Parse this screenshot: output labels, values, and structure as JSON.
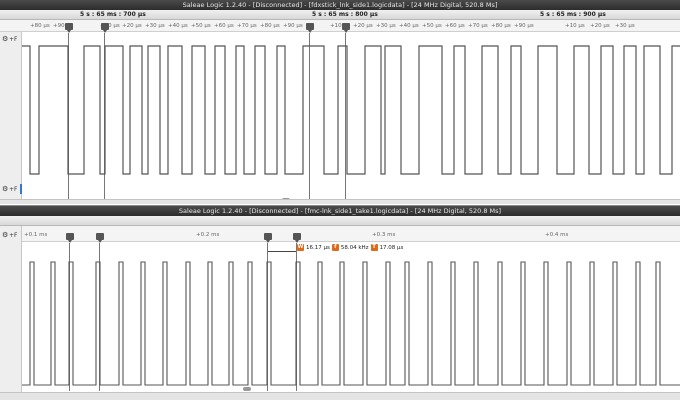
{
  "window_top": {
    "title": "Saleae Logic 1.2.40 - [Disconnected] - [fdxstick_lnk_side1.logicdata] - [24 MHz Digital, 520.8 Ms]",
    "time_labels": [
      "5 s : 65 ms : 700 μs",
      "5 s : 65 ms : 800 μs",
      "5 s : 65 ms : 900 μs"
    ],
    "tick_labels": [
      "+80 μs",
      "+90 μs",
      "+10 μs",
      "+20 μs",
      "+30 μs",
      "+40 μs",
      "+50 μs",
      "+60 μs",
      "+70 μs",
      "+80 μs",
      "+90 μs",
      "+10 μs",
      "+20 μs",
      "+30 μs",
      "+40 μs",
      "+50 μs",
      "+60 μs",
      "+70 μs",
      "+80 μs",
      "+90 μs",
      "+10 μs",
      "+20 μs",
      "+30 μs"
    ],
    "gutter": {
      "top_glyph": "⚙",
      "top_tag": "+F",
      "bottom_glyph": "⚙",
      "bottom_tag": "+F"
    }
  },
  "window_bottom": {
    "title": "Saleae Logic 1.2.40 - [Disconnected] - [fmc-lnk_side1_take1.logicdata] - [24 MHz Digital, 520.8 Ms]",
    "tick_labels": [
      "+0.1 ms",
      "+0.2 ms",
      "+0.3 ms",
      "+0.4 ms"
    ],
    "measurement": {
      "width_tag": "W",
      "width_value": "16.17 μs",
      "freq_tag": "f",
      "freq_value": "58.04 kHz",
      "period_tag": "T",
      "period_value": "17.08 μs"
    },
    "gutter": {
      "top_glyph": "⚙",
      "top_tag": "+F"
    }
  },
  "colors": {
    "trace": "#555555",
    "accent_blue": "#2e7bd6",
    "measure_tag": "#e06a1b",
    "titlebar": "#3a3a3a"
  }
}
